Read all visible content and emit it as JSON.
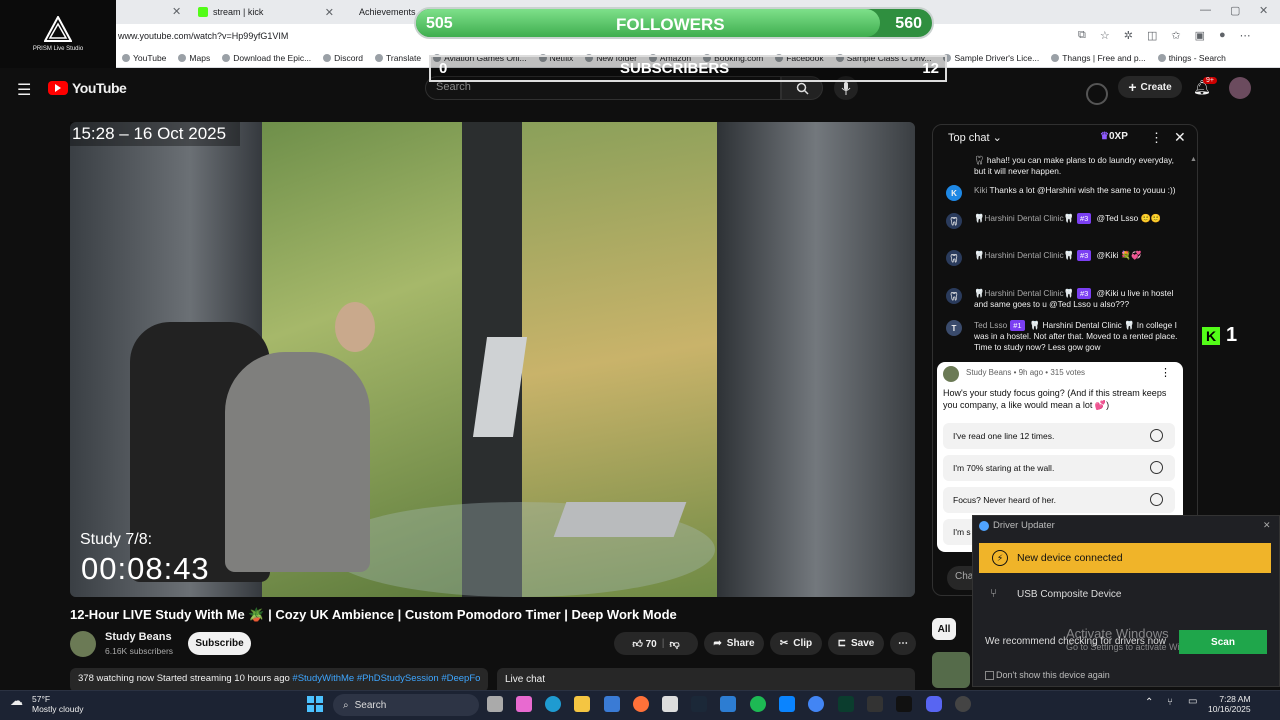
{
  "overlay": {
    "studio_label": "PRISM Live Studio",
    "followers": {
      "current": "505",
      "label": "FOLLOWERS",
      "goal": "560",
      "progress": 0.9
    },
    "subscribers": {
      "current": "0",
      "label": "SUBSCRIBERS",
      "goal": "12"
    },
    "kick_count": "1"
  },
  "browser": {
    "tabs": [
      {
        "label": "stream | kick"
      },
      {
        "label": "Achievements"
      }
    ],
    "url": "www.youtube.com/watch?v=Hp99yfG1VIM",
    "bookmarks": [
      "YouTube",
      "Maps",
      "Download the Epic...",
      "Discord",
      "Translate",
      "Aviation Games Onl...",
      "Netflix",
      "New folder",
      "Amazon",
      "Booking.com",
      "Facebook",
      "Sample Class C Driv...",
      "Sample Driver's Lice...",
      "Thangs | Free and p...",
      "things - Search"
    ]
  },
  "youtube": {
    "logo": "YouTube",
    "search_placeholder": "Search",
    "create_label": "Create",
    "notif_badge": "9+"
  },
  "video": {
    "clock": "15:28 – 16 Oct 2025",
    "study_label": "Study 7/8:",
    "timer": "00:08:43",
    "title": "12-Hour LIVE Study With Me 🪴 | Cozy UK Ambience | Custom Pomodoro Timer | Deep Work Mode",
    "channel": "Study Beans",
    "channel_subs": "6.16K subscribers",
    "subscribe": "Subscribe",
    "likes": "70",
    "share": "Share",
    "clip": "Clip",
    "save": "Save",
    "desc_stats": "378 watching now  Started streaming 10 hours ago",
    "desc_tags": "#StudyWithMe #PhDStudySession #DeepFo",
    "live_chat_label": "Live chat",
    "all_chip": "All"
  },
  "chat": {
    "header": "Top chat",
    "xp": "0XP",
    "messages": [
      {
        "author": "",
        "text": "haha!! you can make plans to do laundry everyday, but it will never happen."
      },
      {
        "author": "Kiki",
        "text": "Thanks a lot @Harshini wish the same to youuu :))"
      },
      {
        "author": "🦷Harshini Dental Clinic🦷",
        "level": "#3",
        "text": "@Ted Lsso 🙂🙂"
      },
      {
        "author": "🦷Harshini Dental Clinic🦷",
        "level": "#3",
        "text": "@Kiki 💐💞"
      },
      {
        "author": "🦷Harshini Dental Clinic🦷",
        "level": "#3",
        "text": "@Kiki u live in hostel and same goes to u @Ted Lsso u also???"
      },
      {
        "author": "Ted Lsso",
        "level": "#1",
        "text": "🦷 Harshini Dental Clinic 🦷 In college I was in a hostel. Not after that. Moved to a rented place. Time to study now? Less gow gow"
      }
    ],
    "input_placeholder": "Cha"
  },
  "poll": {
    "meta": "Study Beans • 9h ago • 315 votes",
    "question": "How's your study focus going? (And if this stream keeps you company, a like would mean a lot 💕)",
    "options": [
      "I've read one line 12 times.",
      "I'm 70% staring at the wall.",
      "Focus? Never heard of her.",
      "I'm s"
    ]
  },
  "driver_popup": {
    "title": "Driver Updater",
    "new_device": "New device connected",
    "device": "USB Composite Device",
    "recommend": "We recommend checking for drivers now",
    "scan": "Scan",
    "dont_show": "Don't show this device again"
  },
  "watermark": {
    "line1": "Activate Windows",
    "line2": "Go to Settings to activate Windows."
  },
  "taskbar": {
    "temp": "57°F",
    "weather": "Mostly cloudy",
    "search": "Search",
    "time": "7:28 AM",
    "date": "10/16/2025"
  }
}
